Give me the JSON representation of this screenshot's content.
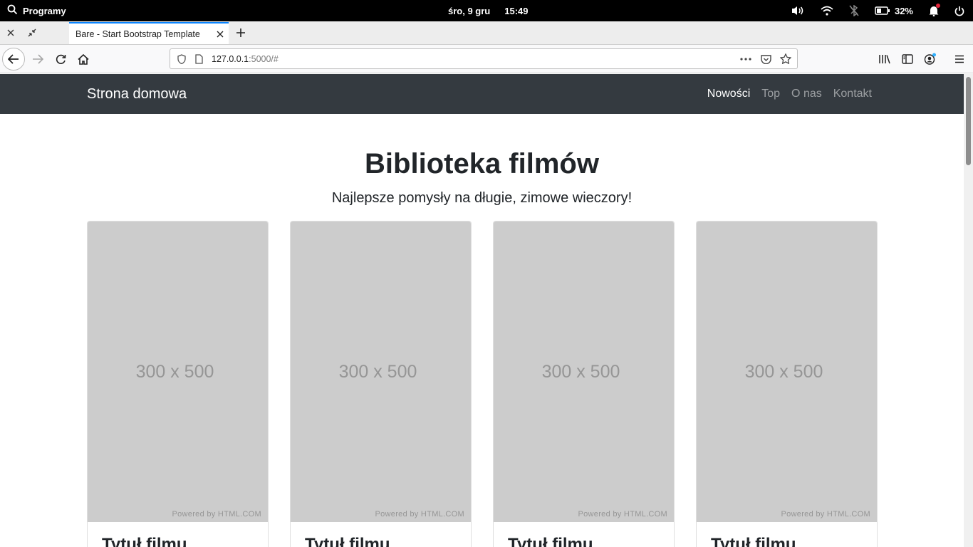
{
  "os_bar": {
    "launcher_label": "Programy",
    "date": "śro,  9 gru",
    "time": "15:49",
    "battery_percent": "32%",
    "icons": [
      "search-icon",
      "volume-icon",
      "wifi-icon",
      "bluetooth-off-icon",
      "battery-icon",
      "notification-bell-icon",
      "power-icon"
    ]
  },
  "browser": {
    "tab_title": "Bare - Start Bootstrap Template",
    "url_host": "127.0.0.1",
    "url_rest": ":5000/#",
    "icons": [
      "close-icon",
      "restore-icon",
      "new-tab-icon",
      "back-icon",
      "forward-icon",
      "reload-icon",
      "home-icon",
      "shield-icon",
      "page-icon",
      "more-icon",
      "pocket-icon",
      "star-icon",
      "library-icon",
      "sidebar-icon",
      "account-icon",
      "menu-icon"
    ],
    "accent_color": "#0a84ff"
  },
  "site": {
    "brand": "Strona domowa",
    "nav": [
      {
        "label": "Nowości",
        "active": true
      },
      {
        "label": "Top",
        "active": false
      },
      {
        "label": "O nas",
        "active": false
      },
      {
        "label": "Kontakt",
        "active": false
      }
    ],
    "title": "Biblioteka filmów",
    "subtitle": "Najlepsze pomysły na długie, zimowe wieczory!",
    "cards": [
      {
        "placeholder": "300 x 500",
        "powered": "Powered by HTML.COM",
        "title": "Tytuł filmu"
      },
      {
        "placeholder": "300 x 500",
        "powered": "Powered by HTML.COM",
        "title": "Tytuł filmu"
      },
      {
        "placeholder": "300 x 500",
        "powered": "Powered by HTML.COM",
        "title": "Tytuł filmu"
      },
      {
        "placeholder": "300 x 500",
        "powered": "Powered by HTML.COM",
        "title": "Tytuł filmu"
      }
    ],
    "navbar_color": "#343a40",
    "placeholder_color": "#cccccc"
  }
}
